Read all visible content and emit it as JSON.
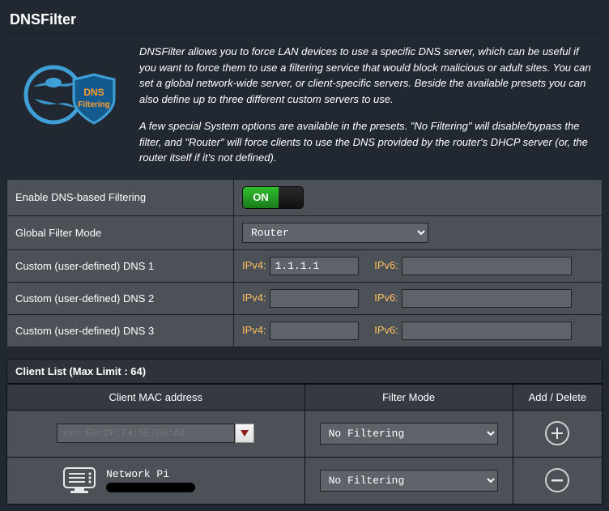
{
  "page_title": "DNSFilter",
  "intro": {
    "p1": "DNSFilter allows you to force LAN devices to use a specific DNS server, which can be useful if you want to force them to use a filtering service that would block malicious or adult sites. You can set a global network-wide server, or client-specific servers. Beside the available presets you can also define up to three different custom servers to use.",
    "p2": "A few special System options are available in the presets. \"No Filtering\" will disable/bypass the filter, and \"Router\" will force clients to use the DNS provided by the router's DHCP server (or, the router itself if it's not defined)."
  },
  "settings": {
    "enable_label": "Enable DNS-based Filtering",
    "enable_on": "ON",
    "global_label": "Global Filter Mode",
    "global_value": "Router",
    "dns1_label": "Custom (user-defined) DNS 1",
    "dns2_label": "Custom (user-defined) DNS 2",
    "dns3_label": "Custom (user-defined) DNS 3",
    "ipv4_label": "IPv4:",
    "ipv6_label": "IPv6:",
    "dns1_v4": "1.1.1.1",
    "dns1_v6": "",
    "dns2_v4": "",
    "dns2_v6": "",
    "dns3_v4": "",
    "dns3_v6": ""
  },
  "client_list": {
    "header": "Client List (Max Limit : 64)",
    "col_mac": "Client MAC address",
    "col_filter": "Filter Mode",
    "col_action": "Add / Delete",
    "mac_placeholder": "ex: F0:2F:74:5E:E0:A8",
    "new_filter": "No Filtering",
    "rows": [
      {
        "name": "Network Pi",
        "filter": "No Filtering"
      }
    ]
  },
  "logo": {
    "line1": "DNS",
    "line2": "Filtering"
  }
}
